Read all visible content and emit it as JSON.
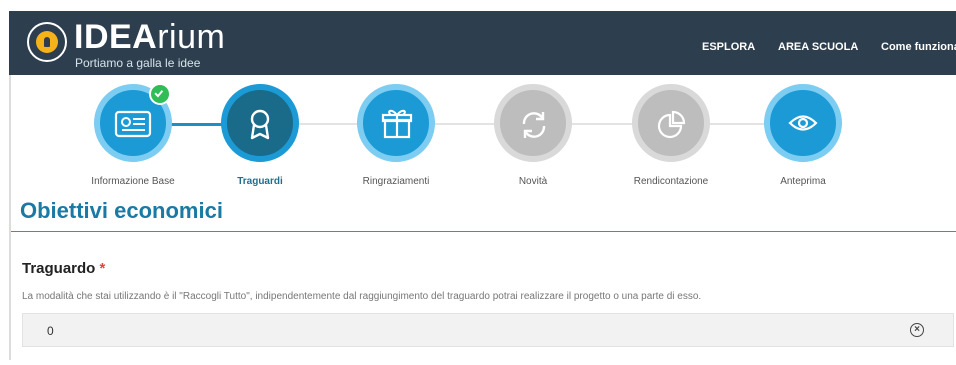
{
  "header": {
    "logo": {
      "brand_bold": "IDEA",
      "brand_light": "rium",
      "tagline": "Portiamo a galla le idee"
    },
    "nav": [
      {
        "label": "ESPLORA"
      },
      {
        "label": "AREA SCUOLA"
      },
      {
        "label": "Come funziona"
      }
    ],
    "colors": {
      "bar": "#2d3e4e",
      "logo_accent": "#f5b21a"
    }
  },
  "steps": [
    {
      "label": "Informazione Base",
      "icon": "id-card-icon",
      "state": "completed"
    },
    {
      "label": "Traguardi",
      "icon": "ribbon-award-icon",
      "state": "current"
    },
    {
      "label": "Ringraziamenti",
      "icon": "gift-icon",
      "state": "available"
    },
    {
      "label": "Novità",
      "icon": "refresh-icon",
      "state": "disabled"
    },
    {
      "label": "Rendicontazione",
      "icon": "pie-chart-icon",
      "state": "disabled"
    },
    {
      "label": "Anteprima",
      "icon": "eye-icon",
      "state": "available"
    }
  ],
  "section": {
    "title": "Obiettivi economici"
  },
  "field": {
    "label": "Traguardo",
    "required_marker": "*",
    "help": "La modalità che stai utilizzando è il \"Raccogli Tutto\", indipendentemente dal raggiungimento del traguardo potrai realizzare il progetto o una parte di esso.",
    "value": "0"
  },
  "colors": {
    "primary": "#1b9ad6",
    "dark": "#1a6a8a",
    "disabled": "#bdbdbd",
    "success": "#2ebd57",
    "required": "#e0443c"
  }
}
